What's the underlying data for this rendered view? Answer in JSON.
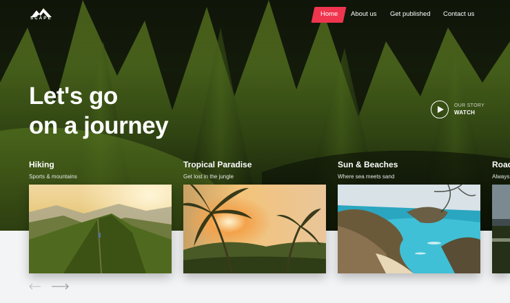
{
  "brand": {
    "logo_text": "SCAPE"
  },
  "nav": {
    "items": [
      {
        "label": "Home",
        "active": true
      },
      {
        "label": "About us"
      },
      {
        "label": "Get published"
      },
      {
        "label": "Contact us"
      }
    ]
  },
  "hero": {
    "headline_line1": "Let's go",
    "headline_line2": "on a journey"
  },
  "story": {
    "label": "OUR STORY",
    "action": "WATCH"
  },
  "cards": [
    {
      "title": "Hiking",
      "subtitle": "Sports & mountains"
    },
    {
      "title": "Tropical Paradise",
      "subtitle": "Get lost in the jungle"
    },
    {
      "title": "Sun & Beaches",
      "subtitle": "Where sea meets sand"
    },
    {
      "title": "Road",
      "subtitle": "Always"
    }
  ],
  "colors": {
    "accent": "#f0354f",
    "background": "#f3f4f6",
    "text_on_dark": "#ffffff"
  },
  "icons": {
    "play": "play-icon",
    "prev": "arrow-left-icon",
    "next": "arrow-right-icon"
  }
}
